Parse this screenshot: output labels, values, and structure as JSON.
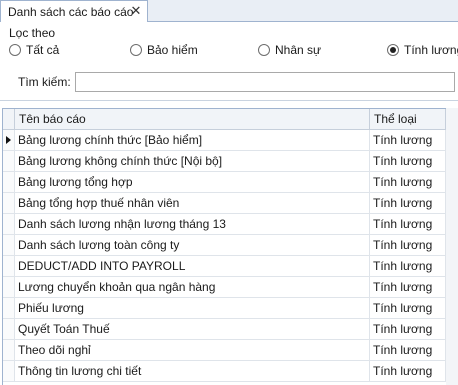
{
  "tab": {
    "title": "Danh sách các báo cáo",
    "close_glyph": "✕"
  },
  "filter": {
    "legend": "Lọc theo",
    "options": [
      {
        "label": "Tất cả",
        "checked": false
      },
      {
        "label": "Bảo hiểm",
        "checked": false
      },
      {
        "label": "Nhân sự",
        "checked": false
      },
      {
        "label": "Tính lương",
        "checked": true
      }
    ],
    "search_label": "Tìm kiếm:",
    "search_value": ""
  },
  "grid": {
    "columns": [
      "Tên báo cáo",
      "Thể loại"
    ],
    "rows": [
      {
        "name": "Bảng lương chính thức [Bảo hiểm]",
        "type": "Tính lương",
        "current": true
      },
      {
        "name": "Bảng lương không chính thức [Nội bộ]",
        "type": "Tính lương"
      },
      {
        "name": "Bảng lương tổng hợp",
        "type": "Tính lương"
      },
      {
        "name": "Bảng tổng hợp thuế nhân viên",
        "type": "Tính lương"
      },
      {
        "name": "Danh sách lương nhận lương tháng 13",
        "type": "Tính lương"
      },
      {
        "name": "Danh sách lương toàn công ty",
        "type": "Tính lương"
      },
      {
        "name": "DEDUCT/ADD INTO PAYROLL",
        "type": "Tính lương"
      },
      {
        "name": "Lương chuyển khoản qua ngân hàng",
        "type": "Tính lương"
      },
      {
        "name": "Phiếu lương",
        "type": "Tính lương"
      },
      {
        "name": "Quyết Toán Thuế",
        "type": "Tính lương"
      },
      {
        "name": "Theo dõi nghỉ",
        "type": "Tính lương"
      },
      {
        "name": "Thông tin  lương chi tiết",
        "type": "Tính lương"
      }
    ]
  }
}
